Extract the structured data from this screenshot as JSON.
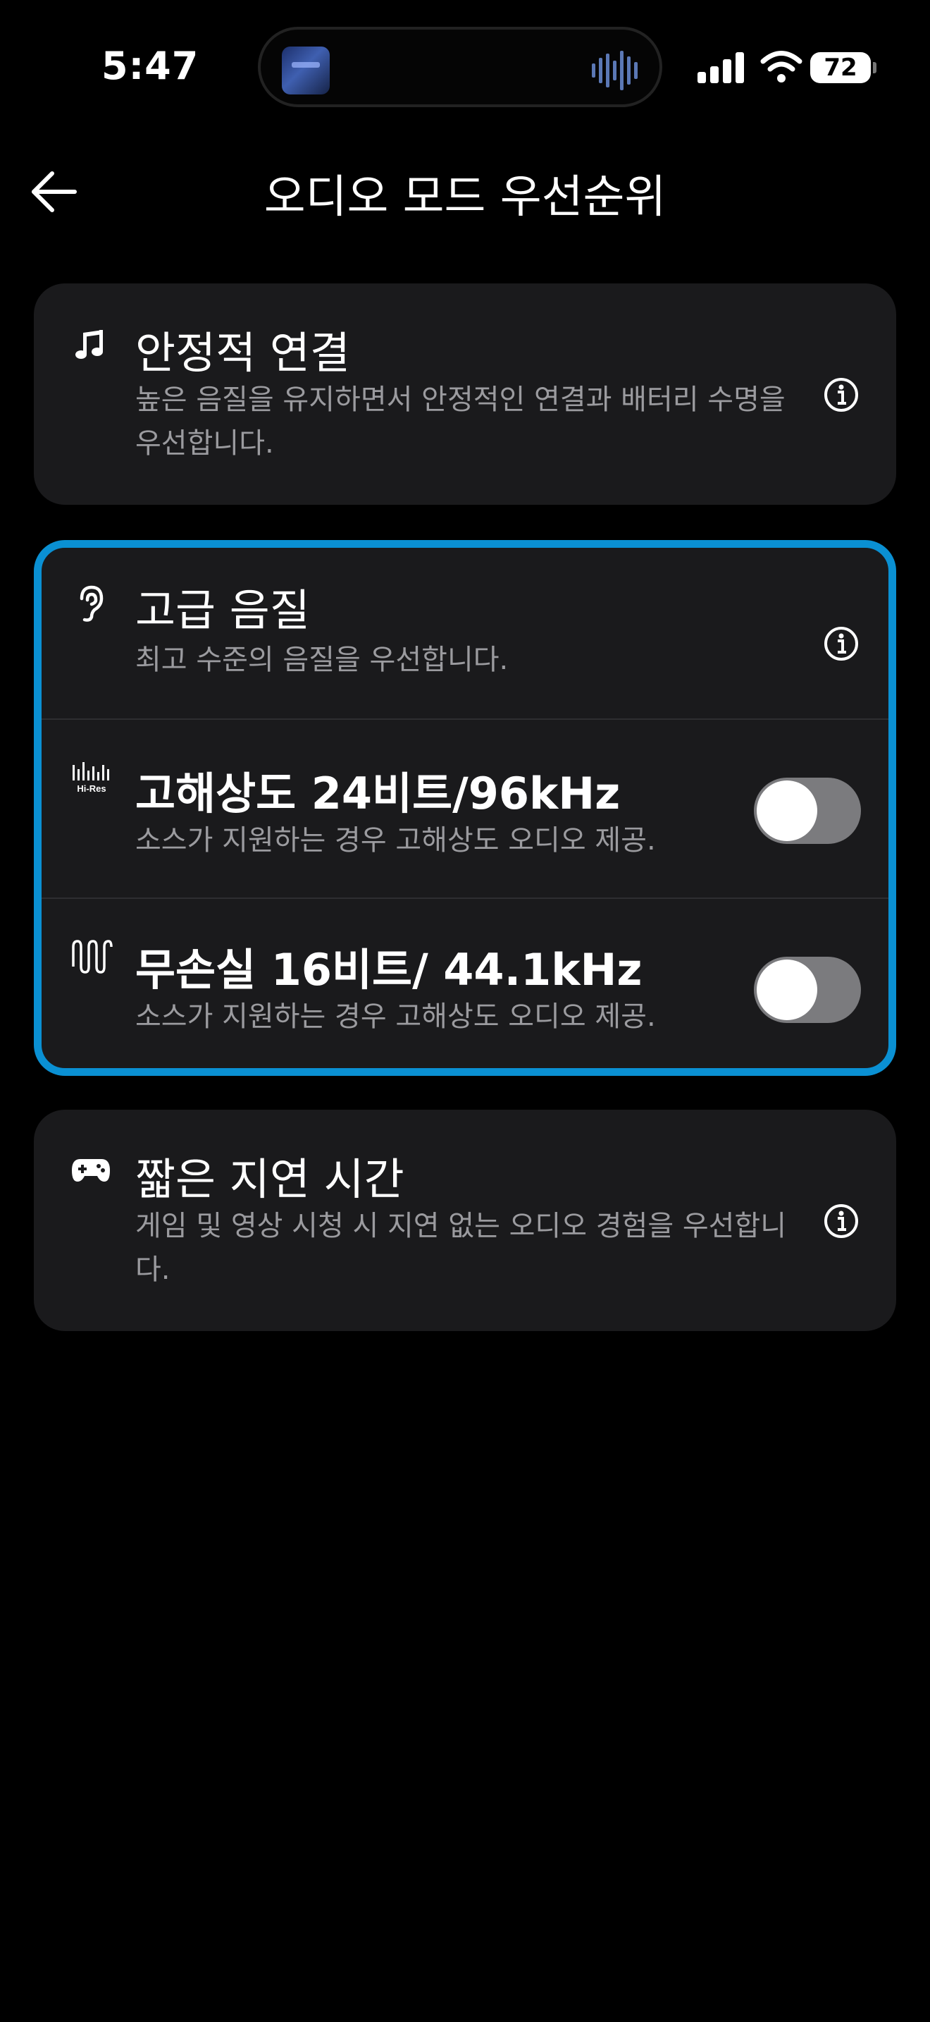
{
  "status_bar": {
    "time": "5:47",
    "battery": "72",
    "icons": [
      "album-art",
      "waveform-icon",
      "signal-icon",
      "wifi-icon",
      "battery-icon"
    ]
  },
  "header": {
    "back_icon": "arrow-left-icon",
    "title": "오디오 모드 우선순위"
  },
  "modes": {
    "stable": {
      "icon": "music-note-icon",
      "title": "안정적 연결",
      "description": "높은 음질을 유지하면서 안정적인 연결과 배터리 수명을 우선합니다.",
      "info_icon": "info-icon"
    },
    "high_quality": {
      "selected": true,
      "accent_color": "#0a90d3",
      "icon": "ear-icon",
      "title": "고급 음질",
      "description": "최고 수준의 음질을 우선합니다.",
      "info_icon": "info-icon",
      "options": [
        {
          "icon": "hi-res-icon",
          "icon_text": "Hi-Res",
          "title": "고해상도 24비트/96kHz",
          "description": "소스가 지원하는 경우 고해상도 오디오 제공.",
          "toggle_on": false
        },
        {
          "icon": "lossless-wave-icon",
          "title": "무손실 16비트/ 44.1kHz",
          "description": "소스가 지원하는 경우 고해상도 오디오 제공.",
          "toggle_on": false
        }
      ]
    },
    "low_latency": {
      "icon": "gamepad-icon",
      "title": "짧은 지연 시간",
      "description": "게임 및 영상 시청 시 지연 없는 오디오 경험을 우선합니다.",
      "info_icon": "info-icon"
    }
  }
}
